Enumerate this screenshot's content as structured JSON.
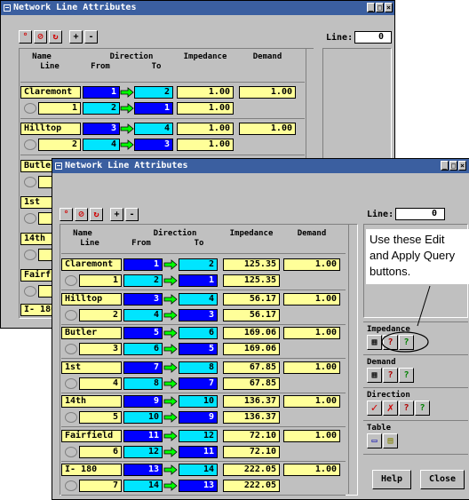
{
  "back_window": {
    "title": "Network Line Attributes",
    "line_label": "Line:",
    "line_value": "0",
    "headers": {
      "name": "Name",
      "line": "Line",
      "direction": "Direction",
      "from": "From",
      "to": "To",
      "impedance": "Impedance",
      "demand": "Demand"
    },
    "rows": [
      {
        "name": "Claremont",
        "n": "1",
        "from1": "1",
        "to1": "2",
        "imp1": "1.00",
        "dem": "1.00",
        "from2": "2",
        "to2": "1",
        "imp2": "1.00"
      },
      {
        "name": "Hilltop",
        "n": "2",
        "from1": "3",
        "to1": "4",
        "imp1": "1.00",
        "dem": "1.00",
        "from2": "4",
        "to2": "3",
        "imp2": "1.00"
      }
    ],
    "partial_names": [
      "Butler",
      "1st",
      "14th",
      "Fairf",
      "I- 180"
    ]
  },
  "front_window": {
    "title": "Network Line Attributes",
    "line_label": "Line:",
    "line_value": "0",
    "headers": {
      "name": "Name",
      "line": "Line",
      "direction": "Direction",
      "from": "From",
      "to": "To",
      "impedance": "Impedance",
      "demand": "Demand"
    },
    "rows": [
      {
        "name": "Claremont",
        "n": "1",
        "from1": "1",
        "to1": "2",
        "imp1": "125.35",
        "dem": "1.00",
        "from2": "2",
        "to2": "1",
        "imp2": "125.35"
      },
      {
        "name": "Hilltop",
        "n": "2",
        "from1": "3",
        "to1": "4",
        "imp1": "56.17",
        "dem": "1.00",
        "from2": "4",
        "to2": "3",
        "imp2": "56.17"
      },
      {
        "name": "Butler",
        "n": "3",
        "from1": "5",
        "to1": "6",
        "imp1": "169.06",
        "dem": "1.00",
        "from2": "6",
        "to2": "5",
        "imp2": "169.06"
      },
      {
        "name": "1st",
        "n": "4",
        "from1": "7",
        "to1": "8",
        "imp1": "67.85",
        "dem": "1.00",
        "from2": "8",
        "to2": "7",
        "imp2": "67.85"
      },
      {
        "name": "14th",
        "n": "5",
        "from1": "9",
        "to1": "10",
        "imp1": "136.37",
        "dem": "1.00",
        "from2": "10",
        "to2": "9",
        "imp2": "136.37"
      },
      {
        "name": "Fairfield",
        "n": "6",
        "from1": "11",
        "to1": "12",
        "imp1": "72.10",
        "dem": "1.00",
        "from2": "12",
        "to2": "11",
        "imp2": "72.10"
      },
      {
        "name": "I- 180",
        "n": "7",
        "from1": "13",
        "to1": "14",
        "imp1": "222.05",
        "dem": "1.00",
        "from2": "14",
        "to2": "13",
        "imp2": "222.05"
      }
    ],
    "sections": {
      "impedance": "Impedance",
      "demand": "Demand",
      "direction": "Direction",
      "table": "Table"
    },
    "help_label": "Help",
    "close_label": "Close"
  },
  "callout": {
    "text": "Use these Edit and Apply Query buttons."
  },
  "colors": {
    "title_bar": "#3b5fa0",
    "from_cell": "#0000ff",
    "to_cell": "#00e5ff",
    "field": "#ffff99",
    "arrow": "#00ff00"
  }
}
